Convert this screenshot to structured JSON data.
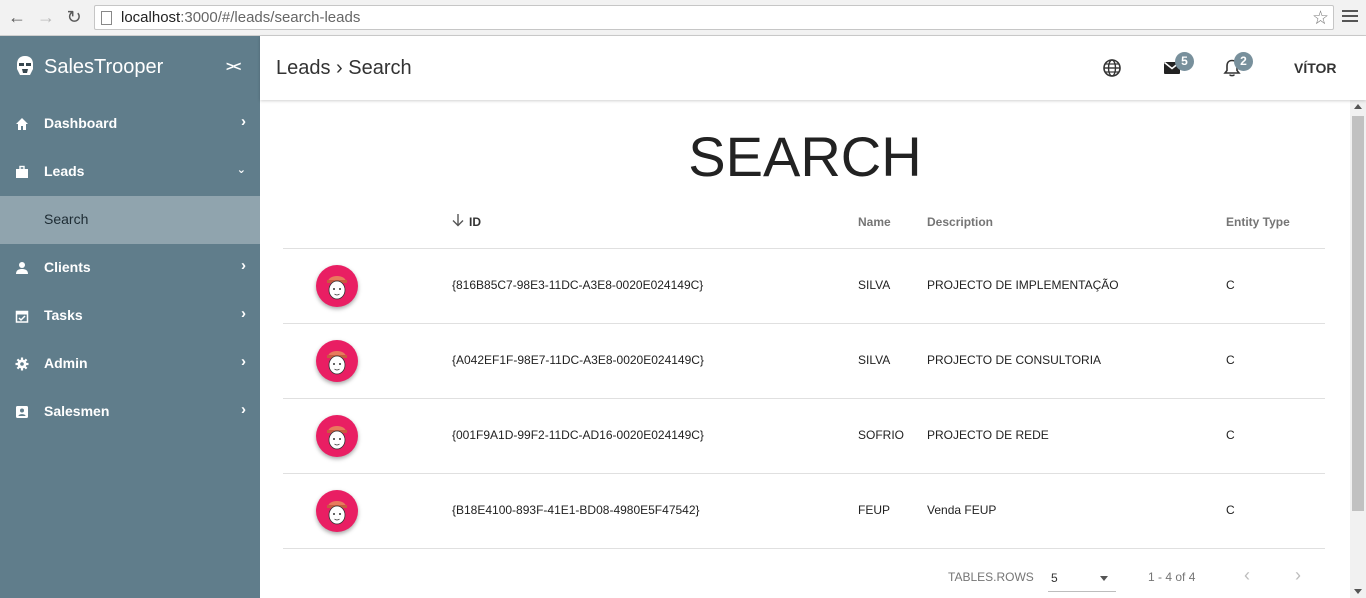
{
  "browser": {
    "url_host": "localhost",
    "url_rest": ":3000/#/leads/search-leads"
  },
  "sidebar": {
    "brand": "SalesTrooper",
    "collapse_label": "><",
    "items": [
      {
        "label": "Dashboard",
        "icon": "home-icon"
      },
      {
        "label": "Leads",
        "icon": "briefcase-icon"
      },
      {
        "label": "Search",
        "icon": ""
      },
      {
        "label": "Clients",
        "icon": "person-icon"
      },
      {
        "label": "Tasks",
        "icon": "calendar-check-icon"
      },
      {
        "label": "Admin",
        "icon": "gear-icon"
      },
      {
        "label": "Salesmen",
        "icon": "contact-card-icon"
      }
    ]
  },
  "header": {
    "breadcrumb": "Leads › Search",
    "mail_count": "5",
    "notification_count": "2",
    "user": "VÍTOR"
  },
  "main": {
    "title": "SEARCH",
    "columns": {
      "id": "ID",
      "name": "Name",
      "description": "Description",
      "entity_type": "Entity Type"
    },
    "rows": [
      {
        "id": "{816B85C7-98E3-11DC-A3E8-0020E024149C}",
        "name": "SILVA",
        "description": "PROJECTO DE IMPLEMENTAÇÃO",
        "entity_type": "C"
      },
      {
        "id": "{A042EF1F-98E7-11DC-A3E8-0020E024149C}",
        "name": "SILVA",
        "description": "PROJECTO DE CONSULTORIA",
        "entity_type": "C"
      },
      {
        "id": "{001F9A1D-99F2-11DC-AD16-0020E024149C}",
        "name": "SOFRIO",
        "description": "PROJECTO DE REDE",
        "entity_type": "C"
      },
      {
        "id": "{B18E4100-893F-41E1-BD08-4980E5F47542}",
        "name": "FEUP",
        "description": "Venda FEUP",
        "entity_type": "C"
      }
    ],
    "pagination": {
      "rows_label": "TABLES.ROWS",
      "rows_value": "5",
      "range": "1 - 4 of 4",
      "prev": "‹",
      "next": "›"
    }
  },
  "colors": {
    "sidebar_bg": "#607d8b",
    "sidebar_active": "#90a4ae",
    "badge": "#78909c",
    "avatar_bg": "#e91e63"
  }
}
